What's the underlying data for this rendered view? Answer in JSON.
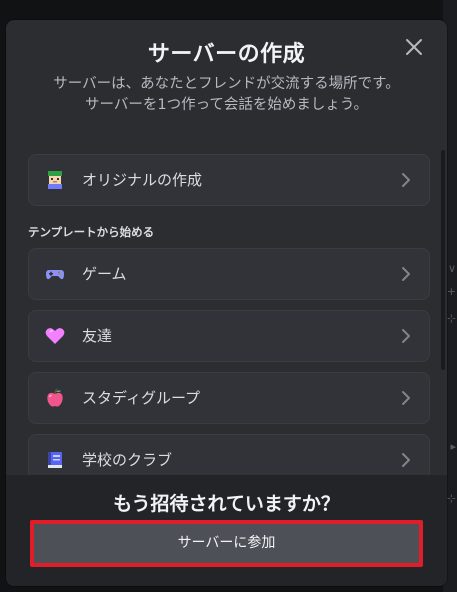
{
  "modal": {
    "title": "サーバーの作成",
    "subtitle_line1": "サーバーは、あなたとフレンドが交流する場所です。",
    "subtitle_line2": "サーバーを1つ作って会話を始めましょう。"
  },
  "create_own": {
    "label": "オリジナルの作成",
    "icon": "pixel-art-creator-icon"
  },
  "templates": {
    "header": "テンプレートから始める",
    "items": [
      {
        "label": "ゲーム",
        "icon": "gamepad-icon"
      },
      {
        "label": "友達",
        "icon": "heart-icon"
      },
      {
        "label": "スタディグループ",
        "icon": "apple-icon"
      },
      {
        "label": "学校のクラブ",
        "icon": "book-icon"
      }
    ]
  },
  "footer": {
    "title": "もう招待されていますか？",
    "join_label": "サーバーに参加"
  },
  "colors": {
    "modal_bg": "#2b2d31",
    "option_bg": "#313338",
    "footer_bg": "#232428",
    "join_button_bg": "#4e5058",
    "highlight_border": "#e01e2a"
  }
}
